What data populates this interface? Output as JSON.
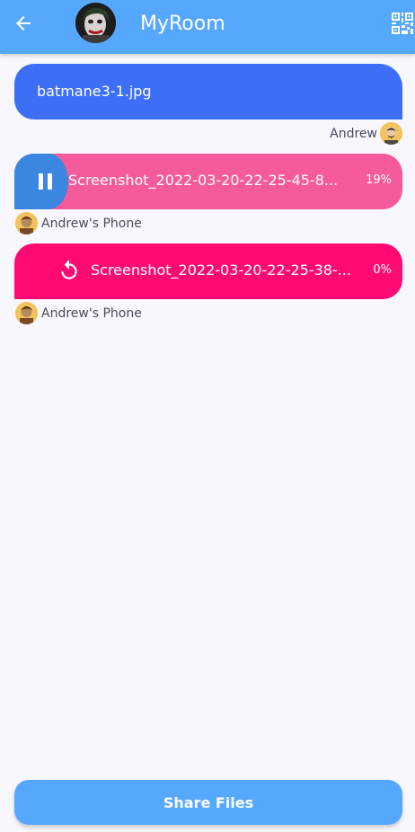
{
  "header": {
    "title": "MyRoom",
    "back_icon": "arrow-left-icon",
    "qr_icon": "qr-code-icon",
    "background": "#56a8ff"
  },
  "messages": [
    {
      "file_name": "batmane3-1.jpg",
      "sender": "Andrew",
      "color": "#3d6ff6"
    },
    {
      "file_name": "Screenshot_2022-03-20-22-25-45-8...",
      "percent": "19%",
      "progress": 0.14,
      "sender": "Andrew's Phone",
      "status": "in-progress",
      "action_icon": "pause-icon",
      "color": "#f55a9a",
      "fill_color": "#3a86e0"
    },
    {
      "file_name": "Screenshot_2022-03-20-22-25-38-...",
      "percent": "0%",
      "progress": 0,
      "sender": "Andrew's Phone",
      "status": "failed",
      "action_icon": "retry-icon",
      "color": "#ff0a72"
    }
  ],
  "footer": {
    "share_label": "Share Files"
  }
}
